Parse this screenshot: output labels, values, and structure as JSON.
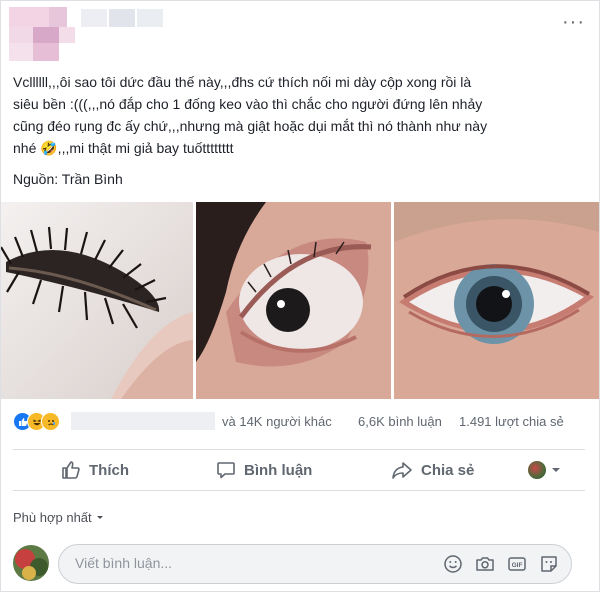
{
  "post": {
    "more_label": "···",
    "text_lines": [
      "Vcllllll,,,ôi sao tôi dức đầu thế này,,,đhs cứ thích nối mi dày cộp xong rồi là",
      "siêu bền :(((,,,nó đắp cho 1 đống keo vào thì chắc cho người đứng lên nhảy",
      "cũng đéo rụng đc ấy chứ,,,nhưng mà giật hoặc dụi mắt thì nó thành như này",
      "nhé 🤣,,,mi thật mi giả bay tuốtttttttt"
    ],
    "source": "Nguồn: Trần Bình"
  },
  "stats": {
    "others": "và 14K người khác",
    "comments": "6,6K bình luận",
    "shares": "1.491 lượt chia sẻ"
  },
  "actions": {
    "like": "Thích",
    "comment": "Bình luận",
    "share": "Chia sẻ"
  },
  "comments": {
    "sort_label": "Phù hợp nhất",
    "placeholder": "Viết bình luận..."
  },
  "icons": {
    "like": "like-icon",
    "comment": "comment-icon",
    "share": "share-icon",
    "emoji": "emoji-icon",
    "camera": "camera-icon",
    "gif": "gif-icon",
    "sticker": "sticker-icon"
  },
  "colors": {
    "like_blue": "#1877f2",
    "haha_yellow": "#f7b928",
    "action_gray": "#606770",
    "border": "#dadde1"
  }
}
